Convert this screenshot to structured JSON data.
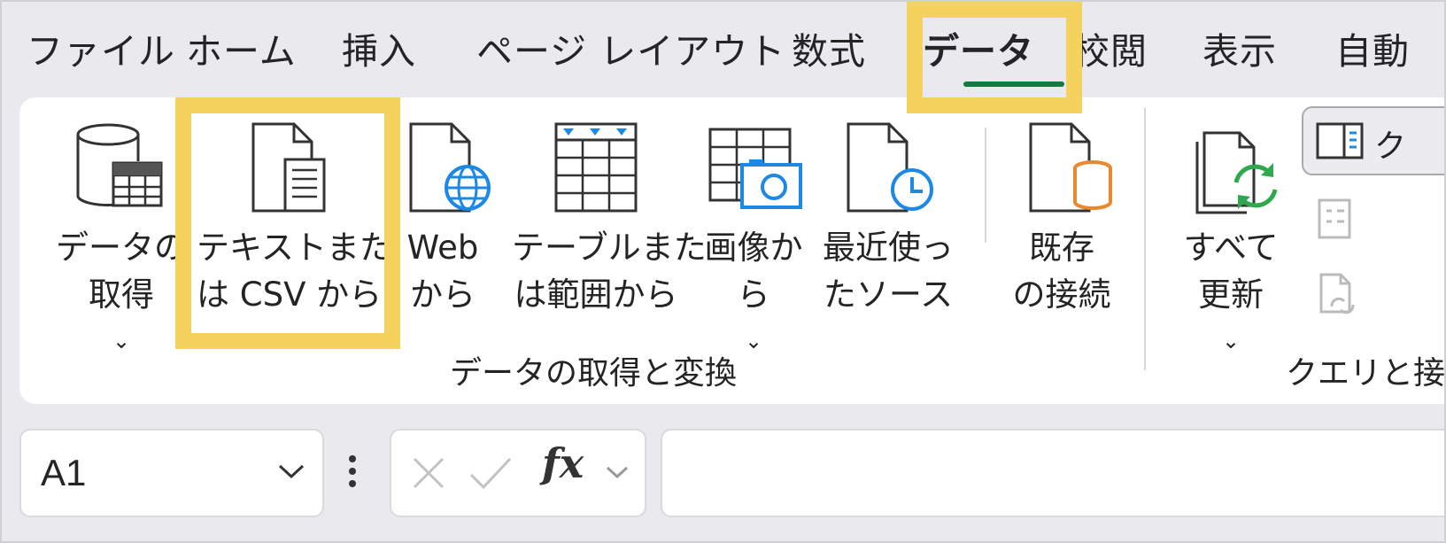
{
  "tabs": [
    {
      "label": "ファイル"
    },
    {
      "label": "ホーム"
    },
    {
      "label": "挿入"
    },
    {
      "label": "ページ レイアウト"
    },
    {
      "label": "数式"
    },
    {
      "label": "データ",
      "active": true
    },
    {
      "label": "校閲"
    },
    {
      "label": "表示"
    },
    {
      "label": "自動"
    }
  ],
  "ribbon": {
    "group1": {
      "label": "データの取得と変換",
      "buttons": [
        {
          "line1": "データの",
          "line2": "取得",
          "dropdown": true,
          "icon": "database-table-icon"
        },
        {
          "line1": "テキストまた",
          "line2": "は CSV から",
          "dropdown": false,
          "icon": "text-file-icon"
        },
        {
          "line1": "Web",
          "line2": "から",
          "dropdown": false,
          "icon": "web-file-icon"
        },
        {
          "line1": "テーブルまた",
          "line2": "は範囲から",
          "dropdown": false,
          "icon": "table-range-icon"
        },
        {
          "line1": "画像か",
          "line2": "ら",
          "dropdown": true,
          "icon": "image-table-icon"
        },
        {
          "line1": "最近使っ",
          "line2": "たソース",
          "dropdown": false,
          "icon": "recent-sources-icon"
        },
        {
          "line1": "既存",
          "line2": "の接続",
          "dropdown": false,
          "icon": "existing-connection-icon"
        }
      ]
    },
    "group2": {
      "label": "クエリと接続",
      "buttons": [
        {
          "line1": "すべて",
          "line2": "更新",
          "dropdown": true,
          "icon": "refresh-all-icon"
        }
      ],
      "side_buttons": [
        {
          "label": "ク",
          "icon": "queries-pane-icon"
        }
      ]
    }
  },
  "formula_bar": {
    "name_box": "A1",
    "fx_label": "fx",
    "formula_value": ""
  },
  "colors": {
    "accent_green": "#107c41",
    "highlight_yellow": "#f5d25e",
    "icon_blue": "#1e88e5",
    "icon_orange": "#e8892f",
    "icon_green": "#2fa84f"
  }
}
